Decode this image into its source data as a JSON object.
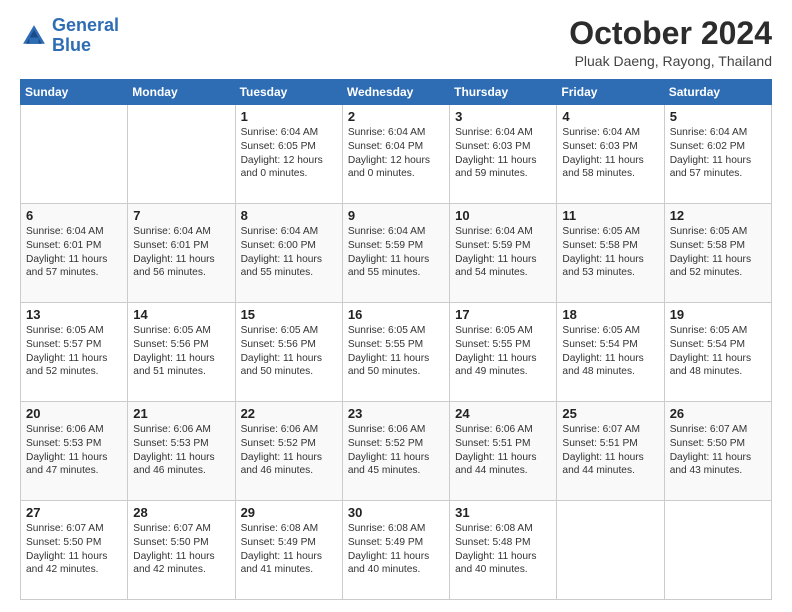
{
  "header": {
    "logo_line1": "General",
    "logo_line2": "Blue",
    "month_title": "October 2024",
    "location": "Pluak Daeng, Rayong, Thailand"
  },
  "days_of_week": [
    "Sunday",
    "Monday",
    "Tuesday",
    "Wednesday",
    "Thursday",
    "Friday",
    "Saturday"
  ],
  "weeks": [
    [
      {
        "num": "",
        "lines": []
      },
      {
        "num": "",
        "lines": []
      },
      {
        "num": "1",
        "lines": [
          "Sunrise: 6:04 AM",
          "Sunset: 6:05 PM",
          "Daylight: 12 hours",
          "and 0 minutes."
        ]
      },
      {
        "num": "2",
        "lines": [
          "Sunrise: 6:04 AM",
          "Sunset: 6:04 PM",
          "Daylight: 12 hours",
          "and 0 minutes."
        ]
      },
      {
        "num": "3",
        "lines": [
          "Sunrise: 6:04 AM",
          "Sunset: 6:03 PM",
          "Daylight: 11 hours",
          "and 59 minutes."
        ]
      },
      {
        "num": "4",
        "lines": [
          "Sunrise: 6:04 AM",
          "Sunset: 6:03 PM",
          "Daylight: 11 hours",
          "and 58 minutes."
        ]
      },
      {
        "num": "5",
        "lines": [
          "Sunrise: 6:04 AM",
          "Sunset: 6:02 PM",
          "Daylight: 11 hours",
          "and 57 minutes."
        ]
      }
    ],
    [
      {
        "num": "6",
        "lines": [
          "Sunrise: 6:04 AM",
          "Sunset: 6:01 PM",
          "Daylight: 11 hours",
          "and 57 minutes."
        ]
      },
      {
        "num": "7",
        "lines": [
          "Sunrise: 6:04 AM",
          "Sunset: 6:01 PM",
          "Daylight: 11 hours",
          "and 56 minutes."
        ]
      },
      {
        "num": "8",
        "lines": [
          "Sunrise: 6:04 AM",
          "Sunset: 6:00 PM",
          "Daylight: 11 hours",
          "and 55 minutes."
        ]
      },
      {
        "num": "9",
        "lines": [
          "Sunrise: 6:04 AM",
          "Sunset: 5:59 PM",
          "Daylight: 11 hours",
          "and 55 minutes."
        ]
      },
      {
        "num": "10",
        "lines": [
          "Sunrise: 6:04 AM",
          "Sunset: 5:59 PM",
          "Daylight: 11 hours",
          "and 54 minutes."
        ]
      },
      {
        "num": "11",
        "lines": [
          "Sunrise: 6:05 AM",
          "Sunset: 5:58 PM",
          "Daylight: 11 hours",
          "and 53 minutes."
        ]
      },
      {
        "num": "12",
        "lines": [
          "Sunrise: 6:05 AM",
          "Sunset: 5:58 PM",
          "Daylight: 11 hours",
          "and 52 minutes."
        ]
      }
    ],
    [
      {
        "num": "13",
        "lines": [
          "Sunrise: 6:05 AM",
          "Sunset: 5:57 PM",
          "Daylight: 11 hours",
          "and 52 minutes."
        ]
      },
      {
        "num": "14",
        "lines": [
          "Sunrise: 6:05 AM",
          "Sunset: 5:56 PM",
          "Daylight: 11 hours",
          "and 51 minutes."
        ]
      },
      {
        "num": "15",
        "lines": [
          "Sunrise: 6:05 AM",
          "Sunset: 5:56 PM",
          "Daylight: 11 hours",
          "and 50 minutes."
        ]
      },
      {
        "num": "16",
        "lines": [
          "Sunrise: 6:05 AM",
          "Sunset: 5:55 PM",
          "Daylight: 11 hours",
          "and 50 minutes."
        ]
      },
      {
        "num": "17",
        "lines": [
          "Sunrise: 6:05 AM",
          "Sunset: 5:55 PM",
          "Daylight: 11 hours",
          "and 49 minutes."
        ]
      },
      {
        "num": "18",
        "lines": [
          "Sunrise: 6:05 AM",
          "Sunset: 5:54 PM",
          "Daylight: 11 hours",
          "and 48 minutes."
        ]
      },
      {
        "num": "19",
        "lines": [
          "Sunrise: 6:05 AM",
          "Sunset: 5:54 PM",
          "Daylight: 11 hours",
          "and 48 minutes."
        ]
      }
    ],
    [
      {
        "num": "20",
        "lines": [
          "Sunrise: 6:06 AM",
          "Sunset: 5:53 PM",
          "Daylight: 11 hours",
          "and 47 minutes."
        ]
      },
      {
        "num": "21",
        "lines": [
          "Sunrise: 6:06 AM",
          "Sunset: 5:53 PM",
          "Daylight: 11 hours",
          "and 46 minutes."
        ]
      },
      {
        "num": "22",
        "lines": [
          "Sunrise: 6:06 AM",
          "Sunset: 5:52 PM",
          "Daylight: 11 hours",
          "and 46 minutes."
        ]
      },
      {
        "num": "23",
        "lines": [
          "Sunrise: 6:06 AM",
          "Sunset: 5:52 PM",
          "Daylight: 11 hours",
          "and 45 minutes."
        ]
      },
      {
        "num": "24",
        "lines": [
          "Sunrise: 6:06 AM",
          "Sunset: 5:51 PM",
          "Daylight: 11 hours",
          "and 44 minutes."
        ]
      },
      {
        "num": "25",
        "lines": [
          "Sunrise: 6:07 AM",
          "Sunset: 5:51 PM",
          "Daylight: 11 hours",
          "and 44 minutes."
        ]
      },
      {
        "num": "26",
        "lines": [
          "Sunrise: 6:07 AM",
          "Sunset: 5:50 PM",
          "Daylight: 11 hours",
          "and 43 minutes."
        ]
      }
    ],
    [
      {
        "num": "27",
        "lines": [
          "Sunrise: 6:07 AM",
          "Sunset: 5:50 PM",
          "Daylight: 11 hours",
          "and 42 minutes."
        ]
      },
      {
        "num": "28",
        "lines": [
          "Sunrise: 6:07 AM",
          "Sunset: 5:50 PM",
          "Daylight: 11 hours",
          "and 42 minutes."
        ]
      },
      {
        "num": "29",
        "lines": [
          "Sunrise: 6:08 AM",
          "Sunset: 5:49 PM",
          "Daylight: 11 hours",
          "and 41 minutes."
        ]
      },
      {
        "num": "30",
        "lines": [
          "Sunrise: 6:08 AM",
          "Sunset: 5:49 PM",
          "Daylight: 11 hours",
          "and 40 minutes."
        ]
      },
      {
        "num": "31",
        "lines": [
          "Sunrise: 6:08 AM",
          "Sunset: 5:48 PM",
          "Daylight: 11 hours",
          "and 40 minutes."
        ]
      },
      {
        "num": "",
        "lines": []
      },
      {
        "num": "",
        "lines": []
      }
    ]
  ]
}
